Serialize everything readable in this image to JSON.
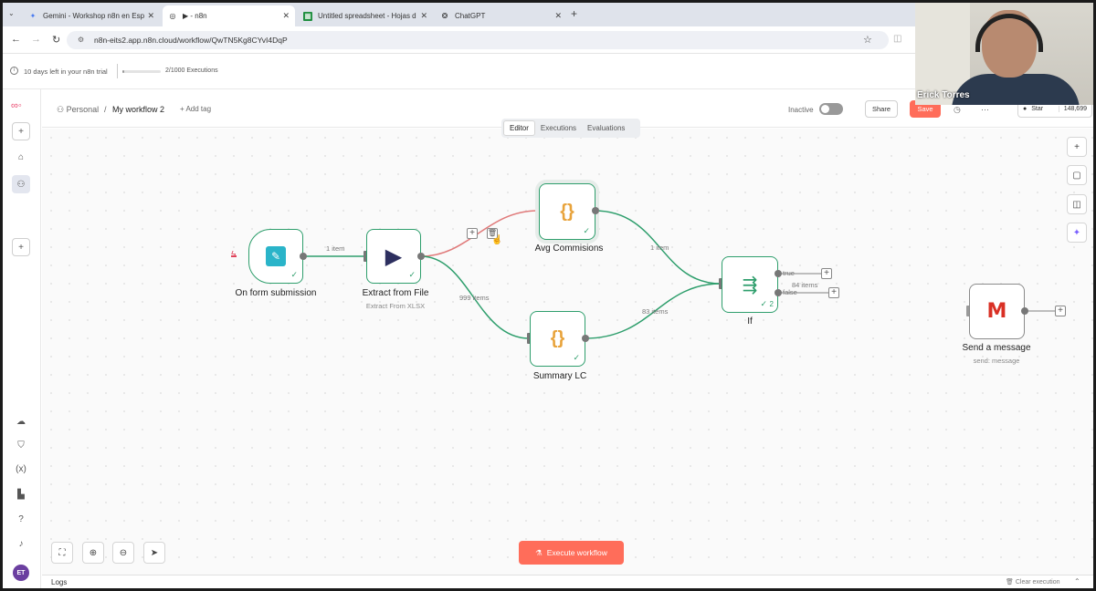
{
  "browser": {
    "tabs": [
      {
        "title": "Gemini - Workshop n8n en Esp",
        "icon": "gemini-icon",
        "active": false
      },
      {
        "title": "▶ - n8n",
        "icon": "globe-icon",
        "active": true
      },
      {
        "title": "Untitled spreadsheet - Hojas d",
        "icon": "sheets-icon",
        "active": false
      },
      {
        "title": "ChatGPT",
        "icon": "chatgpt-icon",
        "active": false
      }
    ],
    "url": "n8n-eits2.app.n8n.cloud/workflow/QwTN5Kg8CYvI4DqP"
  },
  "trial": {
    "days_left": "10 days left in your n8n trial",
    "executions": "2/1000 Executions",
    "progress": 0.002
  },
  "header": {
    "crumb_owner": "Personal",
    "separator": "/",
    "workflow_name": "My workflow 2",
    "add_tag": "+ Add tag",
    "status": "Inactive",
    "share": "Share",
    "save": "Save",
    "github_star": "Star",
    "star_count": "148,699"
  },
  "view_tabs": [
    "Editor",
    "Executions",
    "Evaluations"
  ],
  "nodes": {
    "form": {
      "label": "On form submission"
    },
    "extract": {
      "label": "Extract from File",
      "sub": "Extract From XLSX"
    },
    "avg": {
      "label": "Avg Commisions"
    },
    "summary": {
      "label": "Summary LC"
    },
    "if": {
      "label": "If",
      "count": "2"
    },
    "gmail": {
      "label": "Send a message",
      "sub": "send: message"
    }
  },
  "edges": {
    "form_extract": "1 item",
    "extract_summary": "999 items",
    "avg_if": "1 item",
    "summary_if": "83 items",
    "if_true": "true",
    "if_false": "false",
    "if_false_items": "84 items"
  },
  "execute_button": "Execute workflow",
  "logs": {
    "label": "Logs",
    "clear": "Clear execution"
  },
  "webcam": {
    "name": "Erick Torres"
  },
  "colors": {
    "accent": "#ff6d5a",
    "node_border": "#2e9e6c",
    "avatar": "#6b3fa0"
  }
}
